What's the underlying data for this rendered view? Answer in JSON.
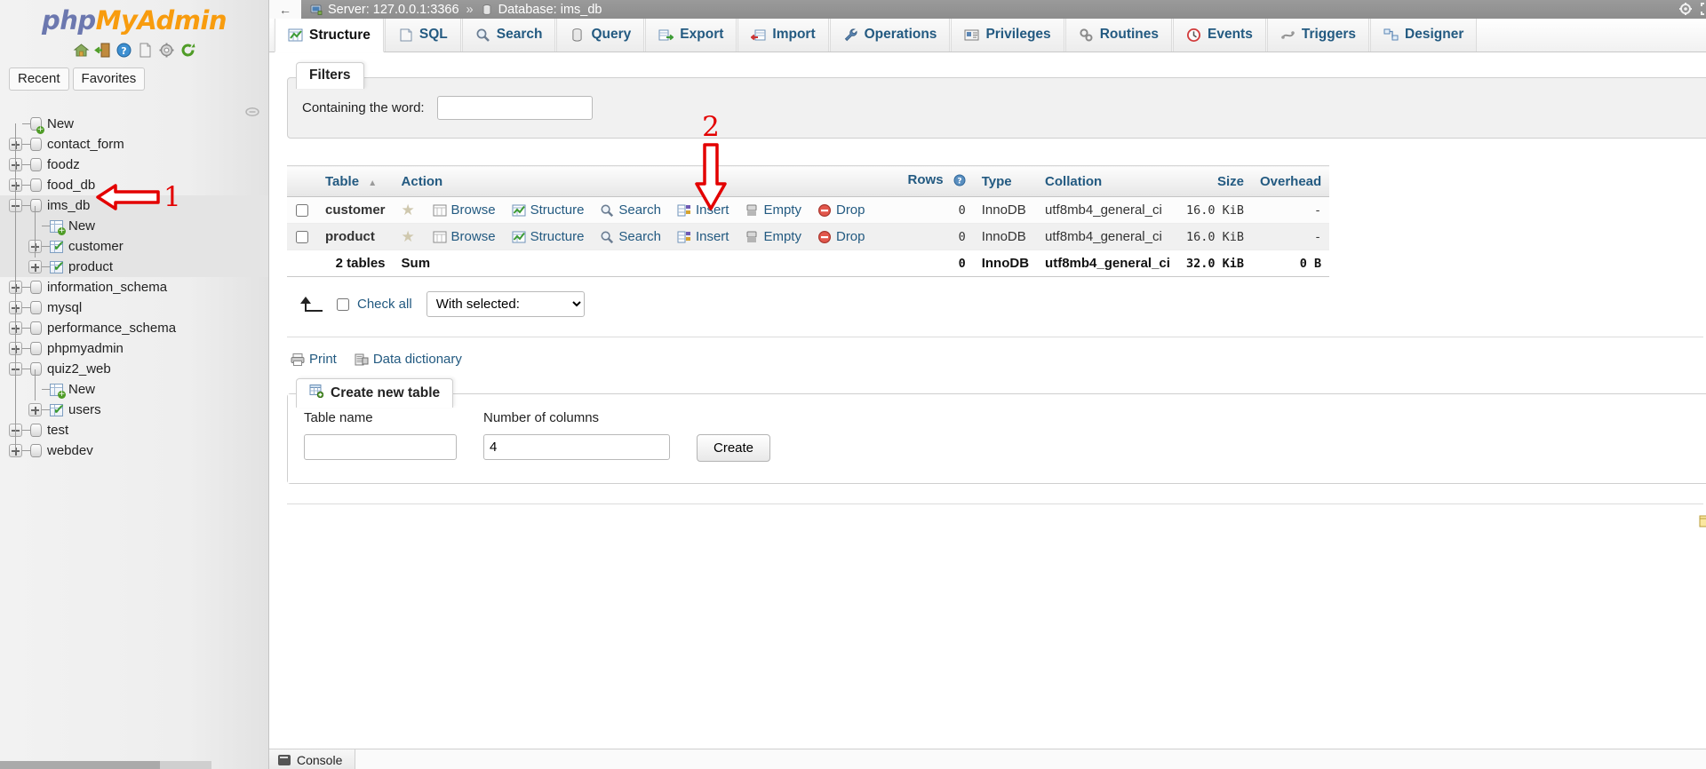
{
  "brand": {
    "php": "php",
    "mysql": "MyAdmin"
  },
  "logo_icons": [
    {
      "name": "home-icon"
    },
    {
      "name": "logout-icon"
    },
    {
      "name": "help-icon"
    },
    {
      "name": "documentation-icon"
    },
    {
      "name": "settings-icon"
    },
    {
      "name": "reload-icon"
    }
  ],
  "quick_tabs": [
    {
      "label": "Recent",
      "name": "recent-tab"
    },
    {
      "label": "Favorites",
      "name": "favorites-tab"
    }
  ],
  "navigation": {
    "tree": [
      {
        "label": "New",
        "kind": "db-new",
        "toggle": "none",
        "depth": 0,
        "selected": false
      },
      {
        "label": "contact_form",
        "kind": "db",
        "toggle": "plus",
        "depth": 0,
        "selected": false
      },
      {
        "label": "foodz",
        "kind": "db",
        "toggle": "plus",
        "depth": 0,
        "selected": false
      },
      {
        "label": "food_db",
        "kind": "db",
        "toggle": "plus",
        "depth": 0,
        "selected": false
      },
      {
        "label": "ims_db",
        "kind": "db",
        "toggle": "minus",
        "depth": 0,
        "selected": true
      },
      {
        "label": "New",
        "kind": "table-new",
        "toggle": "none",
        "depth": 1,
        "selected": true
      },
      {
        "label": "customer",
        "kind": "table",
        "toggle": "plus",
        "depth": 1,
        "selected": true
      },
      {
        "label": "product",
        "kind": "table",
        "toggle": "plus",
        "depth": 1,
        "selected": true
      },
      {
        "label": "information_schema",
        "kind": "db",
        "toggle": "plus",
        "depth": 0,
        "selected": false
      },
      {
        "label": "mysql",
        "kind": "db",
        "toggle": "plus",
        "depth": 0,
        "selected": false
      },
      {
        "label": "performance_schema",
        "kind": "db",
        "toggle": "plus",
        "depth": 0,
        "selected": false
      },
      {
        "label": "phpmyadmin",
        "kind": "db",
        "toggle": "plus",
        "depth": 0,
        "selected": false
      },
      {
        "label": "quiz2_web",
        "kind": "db",
        "toggle": "minus",
        "depth": 0,
        "selected": false
      },
      {
        "label": "New",
        "kind": "table-new",
        "toggle": "none",
        "depth": 1,
        "selected": false
      },
      {
        "label": "users",
        "kind": "table",
        "toggle": "plus",
        "depth": 1,
        "selected": false
      },
      {
        "label": "test",
        "kind": "db",
        "toggle": "minus",
        "depth": 0,
        "selected": false
      },
      {
        "label": "webdev",
        "kind": "db",
        "toggle": "plus",
        "depth": 0,
        "selected": false
      }
    ]
  },
  "breadcrumb": {
    "back_label": "←",
    "server_label": "Server: 127.0.0.1:3366",
    "separator": "»",
    "database_label": "Database: ims_db"
  },
  "top_right_icons": [
    {
      "name": "settings-gear-icon"
    },
    {
      "name": "fullscreen-icon"
    }
  ],
  "tabs": [
    {
      "label": "Structure",
      "icon": "structure-icon",
      "active": true
    },
    {
      "label": "SQL",
      "icon": "sql-icon",
      "active": false
    },
    {
      "label": "Search",
      "icon": "search-icon",
      "active": false
    },
    {
      "label": "Query",
      "icon": "query-icon",
      "active": false
    },
    {
      "label": "Export",
      "icon": "export-icon",
      "active": false
    },
    {
      "label": "Import",
      "icon": "import-icon",
      "active": false
    },
    {
      "label": "Operations",
      "icon": "operations-wrench-icon",
      "active": false
    },
    {
      "label": "Privileges",
      "icon": "privileges-icon",
      "active": false
    },
    {
      "label": "Routines",
      "icon": "routines-gears-icon",
      "active": false
    },
    {
      "label": "Events",
      "icon": "events-clock-icon",
      "active": false
    },
    {
      "label": "Triggers",
      "icon": "triggers-icon",
      "active": false
    },
    {
      "label": "Designer",
      "icon": "designer-icon",
      "active": false
    }
  ],
  "filters": {
    "legend": "Filters",
    "containing_label": "Containing the word:",
    "containing_value": "",
    "containing_placeholder": ""
  },
  "tables_panel": {
    "columns": {
      "table": "Table",
      "action": "Action",
      "rows": "Rows",
      "type": "Type",
      "collation": "Collation",
      "size": "Size",
      "overhead": "Overhead"
    },
    "sort_indicator": "▲",
    "actions": [
      "Browse",
      "Structure",
      "Search",
      "Insert",
      "Empty",
      "Drop"
    ],
    "rows": [
      {
        "name": "customer",
        "rows": "0",
        "type": "InnoDB",
        "collation": "utf8mb4_general_ci",
        "size": "16.0 KiB",
        "overhead": "-"
      },
      {
        "name": "product",
        "rows": "0",
        "type": "InnoDB",
        "collation": "utf8mb4_general_ci",
        "size": "16.0 KiB",
        "overhead": "-"
      }
    ],
    "summary": {
      "count_label": "2 tables",
      "sum_label": "Sum",
      "rows": "0",
      "type": "InnoDB",
      "collation": "utf8mb4_general_ci",
      "size": "32.0 KiB",
      "overhead": "0 B"
    }
  },
  "bulk": {
    "check_all": "Check all",
    "with_selected_label": "With selected:",
    "with_selected_options": [
      "With selected:"
    ]
  },
  "footer_links": [
    {
      "label": "Print",
      "icon": "printer-icon"
    },
    {
      "label": "Data dictionary",
      "icon": "data-dictionary-icon"
    }
  ],
  "create_table": {
    "legend": "Create new table",
    "table_name_label": "Table name",
    "table_name_value": "",
    "columns_label": "Number of columns",
    "columns_value": "4",
    "create_button": "Create"
  },
  "console": {
    "label": "Console"
  },
  "annotations": [
    {
      "id": "1",
      "label": "1",
      "target": "ims_db database node"
    },
    {
      "id": "2",
      "label": "2",
      "target": "Drop action on customer row"
    }
  ],
  "colors": {
    "link": "#235a81",
    "brand_php": "#6c78af",
    "brand_mysql": "#f89c0e",
    "annotation_red": "#e30000"
  }
}
